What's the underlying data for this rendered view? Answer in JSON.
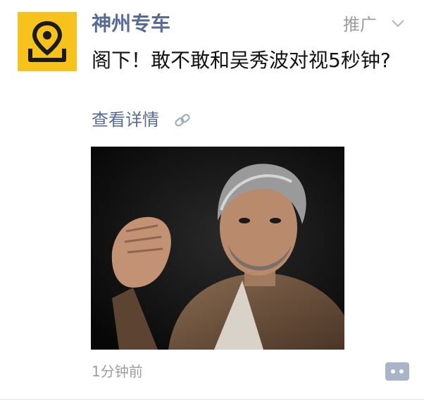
{
  "post": {
    "account_name": "神州专车",
    "promo_label": "推广",
    "text": "阁下！敢不敢和吴秀波对视5秒钟?",
    "details_link": "查看详情",
    "timestamp": "1分钟前"
  },
  "colors": {
    "link_blue": "#576b95",
    "logo_yellow": "#f7c21b",
    "gray_text": "#9e9e9e"
  },
  "icons": {
    "logo": "location-pin-logo-icon",
    "promo_toggle": "chevron-down-icon",
    "link": "link-chain-icon",
    "comment": "comment-dots-icon"
  }
}
